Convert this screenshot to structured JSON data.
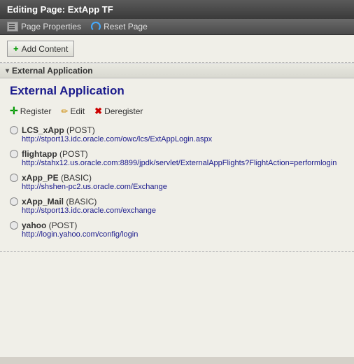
{
  "header": {
    "label": "Editing Page:",
    "page_name": "ExtApp TF"
  },
  "toolbar": {
    "page_properties_label": "Page Properties",
    "reset_page_label": "Reset Page"
  },
  "add_content_btn": "+ Add Content",
  "section": {
    "collapse_symbol": "▾",
    "label": "External Application"
  },
  "widget": {
    "title": "External Application",
    "actions": {
      "register": "Register",
      "edit": "Edit",
      "deregister": "Deregister"
    }
  },
  "apps": [
    {
      "name": "LCS_xApp",
      "auth": "POST",
      "url": "http://stport13.idc.oracle.com/owc/lcs/ExtAppLogin.aspx"
    },
    {
      "name": "flightapp",
      "auth": "POST",
      "url": "http://stahx12.us.oracle.com:8899/jpdk/servlet/ExternalAppFlights?FlightAction=performlogin"
    },
    {
      "name": "xApp_PE",
      "auth": "BASIC",
      "url": "http://shshen-pc2.us.oracle.com/Exchange"
    },
    {
      "name": "xApp_Mail",
      "auth": "BASIC",
      "url": "http://stport13.idc.oracle.com/exchange"
    },
    {
      "name": "yahoo",
      "auth": "POST",
      "url": "http://login.yahoo.com/config/login"
    }
  ]
}
